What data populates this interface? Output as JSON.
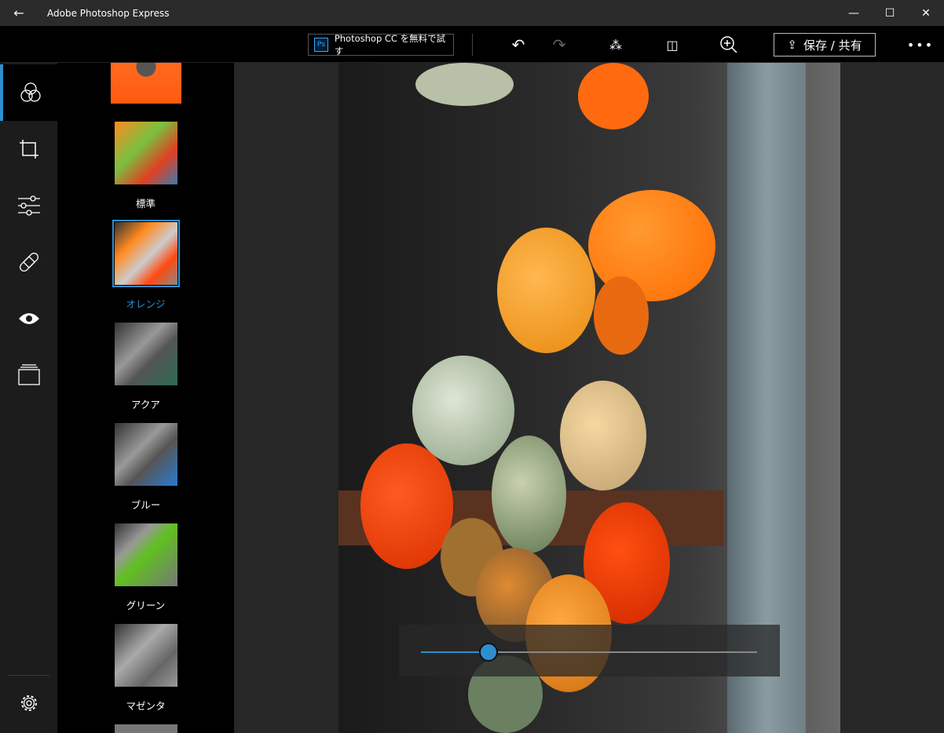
{
  "window": {
    "title": "Adobe Photoshop Express"
  },
  "toolbar": {
    "ps_promo": "Photoshop CC を無料で試す",
    "ps_badge": "Ps",
    "share_label": "保存 / 共有"
  },
  "rail": {
    "items": [
      "looks",
      "crop",
      "adjustments",
      "healing",
      "red-eye",
      "borders"
    ]
  },
  "filters": {
    "items": [
      {
        "label": "標準",
        "selected": false
      },
      {
        "label": "オレンジ",
        "selected": true
      },
      {
        "label": "アクア",
        "selected": false
      },
      {
        "label": "ブルー",
        "selected": false
      },
      {
        "label": "グリーン",
        "selected": false
      },
      {
        "label": "マゼンタ",
        "selected": false
      }
    ]
  },
  "slider": {
    "value": 0.2
  },
  "colors": {
    "accent": "#2d8fd0"
  }
}
